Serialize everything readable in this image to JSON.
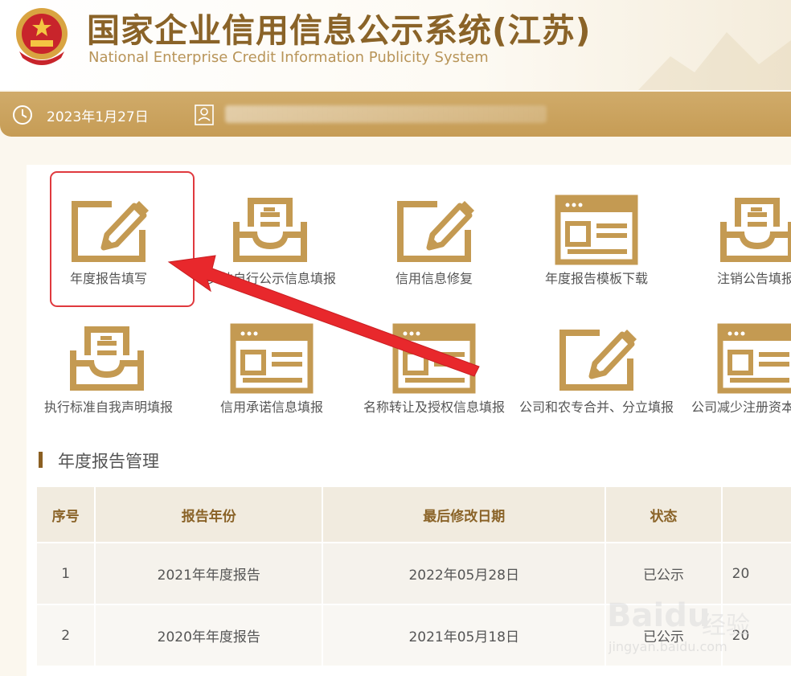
{
  "header": {
    "title_cn": "国家企业信用信息公示系统(江苏)",
    "title_en": "National Enterprise Credit Information Publicity System"
  },
  "infobar": {
    "date": "2023年1月27日"
  },
  "tiles": [
    {
      "label": "年度报告填写",
      "icon": "pencil-edit-icon"
    },
    {
      "label": "其他自行公示信息填报",
      "icon": "inbox-tray-icon"
    },
    {
      "label": "信用信息修复",
      "icon": "pencil-edit-icon"
    },
    {
      "label": "年度报告模板下载",
      "icon": "web-window-icon"
    },
    {
      "label": "注销公告填报",
      "icon": "inbox-tray-icon"
    },
    {
      "label": "执行标准自我声明填报",
      "icon": "inbox-tray-icon"
    },
    {
      "label": "信用承诺信息填报",
      "icon": "web-window-icon"
    },
    {
      "label": "名称转让及授权信息填报",
      "icon": "web-window-icon"
    },
    {
      "label": "公司和农专合并、分立填报",
      "icon": "pencil-edit-icon"
    },
    {
      "label": "公司减少注册资本",
      "icon": "web-window-icon"
    }
  ],
  "section": {
    "title": "年度报告管理"
  },
  "table": {
    "headers": [
      "序号",
      "报告年份",
      "最后修改日期",
      "状态",
      ""
    ],
    "rows": [
      [
        "1",
        "2021年年度报告",
        "2022年05月28日",
        "已公示",
        "20"
      ],
      [
        "2",
        "2020年年度报告",
        "2021年05月18日",
        "已公示",
        "20"
      ]
    ]
  },
  "watermark": {
    "brand": "Baidu",
    "jingyan": "经验",
    "url": "jingyan.baidu.com"
  },
  "colors": {
    "gold": "#c49a52",
    "brown": "#8a6328",
    "highlight": "#e0393e",
    "arrow": "#e8282c"
  }
}
